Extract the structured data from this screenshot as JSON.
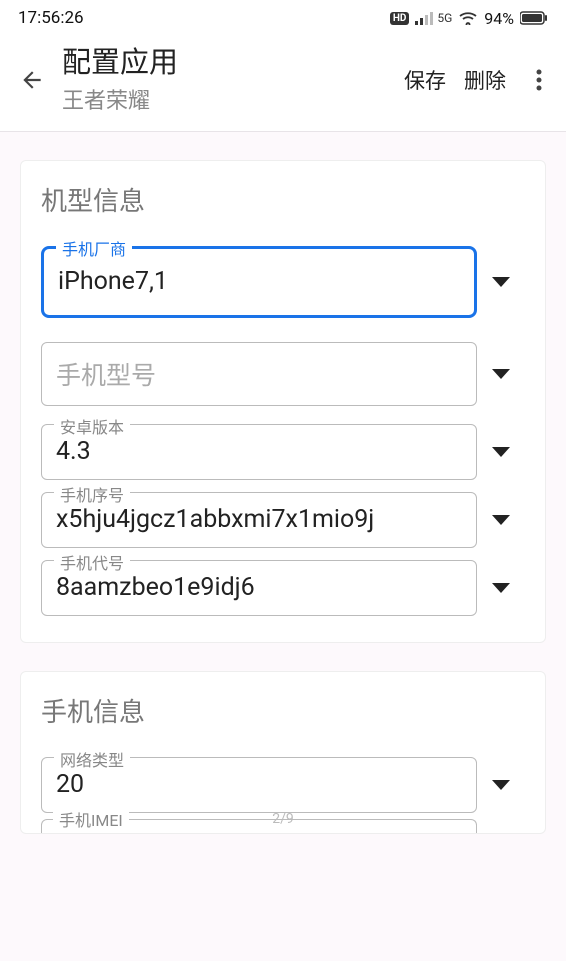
{
  "status": {
    "time": "17:56:26",
    "hd": "HD",
    "net": "5G",
    "battery": "94%"
  },
  "header": {
    "title": "配置应用",
    "subtitle": "王者荣耀",
    "save": "保存",
    "delete": "删除"
  },
  "section1": {
    "title": "机型信息",
    "fields": {
      "vendor": {
        "label": "手机厂商",
        "value": "iPhone7,1"
      },
      "model": {
        "label": "手机型号",
        "value": ""
      },
      "android": {
        "label": "安卓版本",
        "value": "4.3"
      },
      "serial": {
        "label": "手机序号",
        "value": "x5hju4jgcz1abbxmi7x1mio9j"
      },
      "codename": {
        "label": "手机代号",
        "value": "8aamzbeo1e9idj6"
      }
    }
  },
  "section2": {
    "title": "手机信息",
    "fields": {
      "network": {
        "label": "网络类型",
        "value": "20"
      },
      "imei": {
        "label": "手机IMEI"
      }
    }
  },
  "page": "2/9"
}
